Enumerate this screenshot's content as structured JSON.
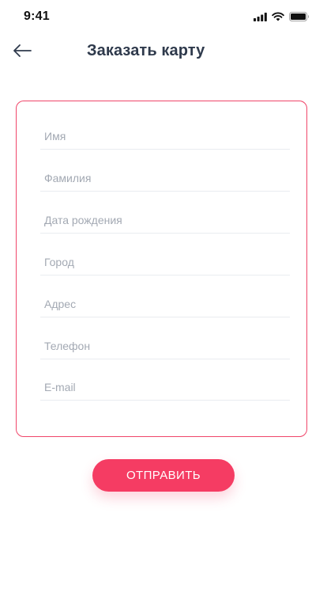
{
  "status_bar": {
    "time": "9:41",
    "icons": [
      "signal-icon",
      "wifi-icon",
      "battery-icon"
    ]
  },
  "header": {
    "back_icon": "arrow-left-icon",
    "title": "Заказать карту"
  },
  "form": {
    "fields": [
      {
        "name": "first-name",
        "placeholder": "Имя",
        "value": ""
      },
      {
        "name": "last-name",
        "placeholder": "Фамилия",
        "value": ""
      },
      {
        "name": "birth-date",
        "placeholder": "Дата рождения",
        "value": ""
      },
      {
        "name": "city",
        "placeholder": "Город",
        "value": ""
      },
      {
        "name": "address",
        "placeholder": "Адрес",
        "value": ""
      },
      {
        "name": "phone",
        "placeholder": "Телефон",
        "value": ""
      },
      {
        "name": "email",
        "placeholder": "E-mail",
        "value": ""
      }
    ]
  },
  "submit": {
    "label": "ОТПРАВИТЬ"
  },
  "colors": {
    "accent": "#f53c63",
    "card_border": "#f0466a",
    "title": "#2f3a4c",
    "placeholder": "#a3a9b3",
    "divider": "#e9ecf0"
  }
}
